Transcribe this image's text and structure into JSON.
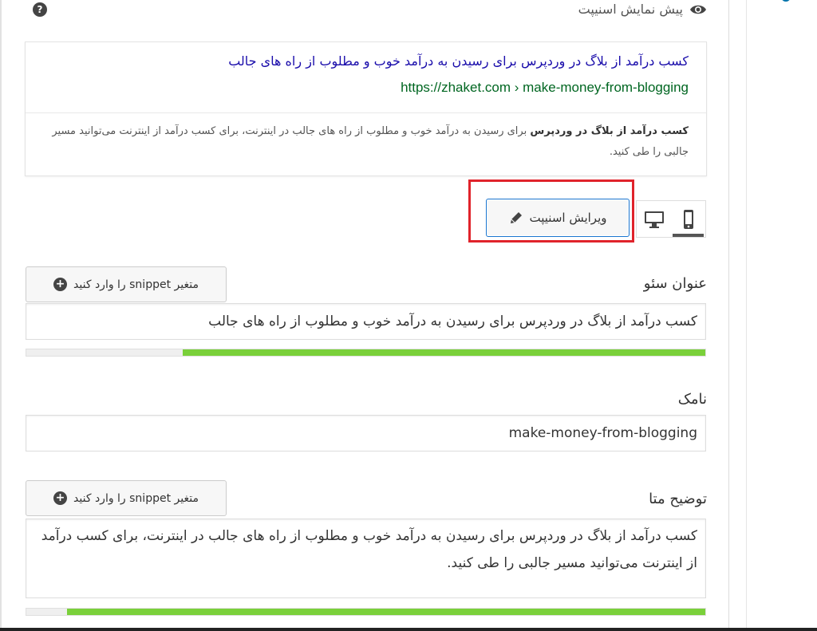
{
  "snippet_preview": {
    "heading": "پیش نمایش اسنیپت",
    "help_icon_glyph": "?",
    "title": "کسب درآمد از بلاگ در وردپرس برای رسیدن به درآمد خوب و مطلوب از راه های جالب",
    "url": "https://zhaket.com › make-money-from-blogging",
    "description_bold": "کسب درآمد از بلاگ در وردپرس",
    "description_rest": " برای رسیدن به درآمد خوب و مطلوب از راه های جالب در اینترنت، برای کسب درآمد از اینترنت می‌توانید مسیر جالبی را طی کنید."
  },
  "toolbar": {
    "edit_snippet_label": "ویرایش اسنیپت",
    "edit_icon": "pencil-icon",
    "desktop_icon": "desktop-icon",
    "mobile_icon": "mobile-icon",
    "active_device": "mobile"
  },
  "seo_title": {
    "label": "عنوان سئو",
    "insert_variable_label": "متغیر snippet را وارد کنید",
    "value": "کسب درآمد از بلاگ در وردپرس برای رسیدن به درآمد خوب و مطلوب از راه های جالب",
    "progress_percent": 77
  },
  "slug": {
    "label": "نامک",
    "value": "make-money-from-blogging"
  },
  "meta_description": {
    "label": "توضیح متا",
    "insert_variable_label": "متغیر snippet را وارد کنید",
    "value": "کسب درآمد از بلاگ در وردپرس برای رسیدن به درآمد خوب و مطلوب از راه های جالب در اینترنت، برای کسب درآمد از اینترنت می‌توانید مسیر جالبی را طی کنید.",
    "progress_percent": 94
  },
  "colors": {
    "progress_good": "#7ad03a",
    "link_title": "#1a0dab",
    "link_url": "#006621",
    "highlight": "#e0232b",
    "focus_border": "#1a75cf"
  }
}
